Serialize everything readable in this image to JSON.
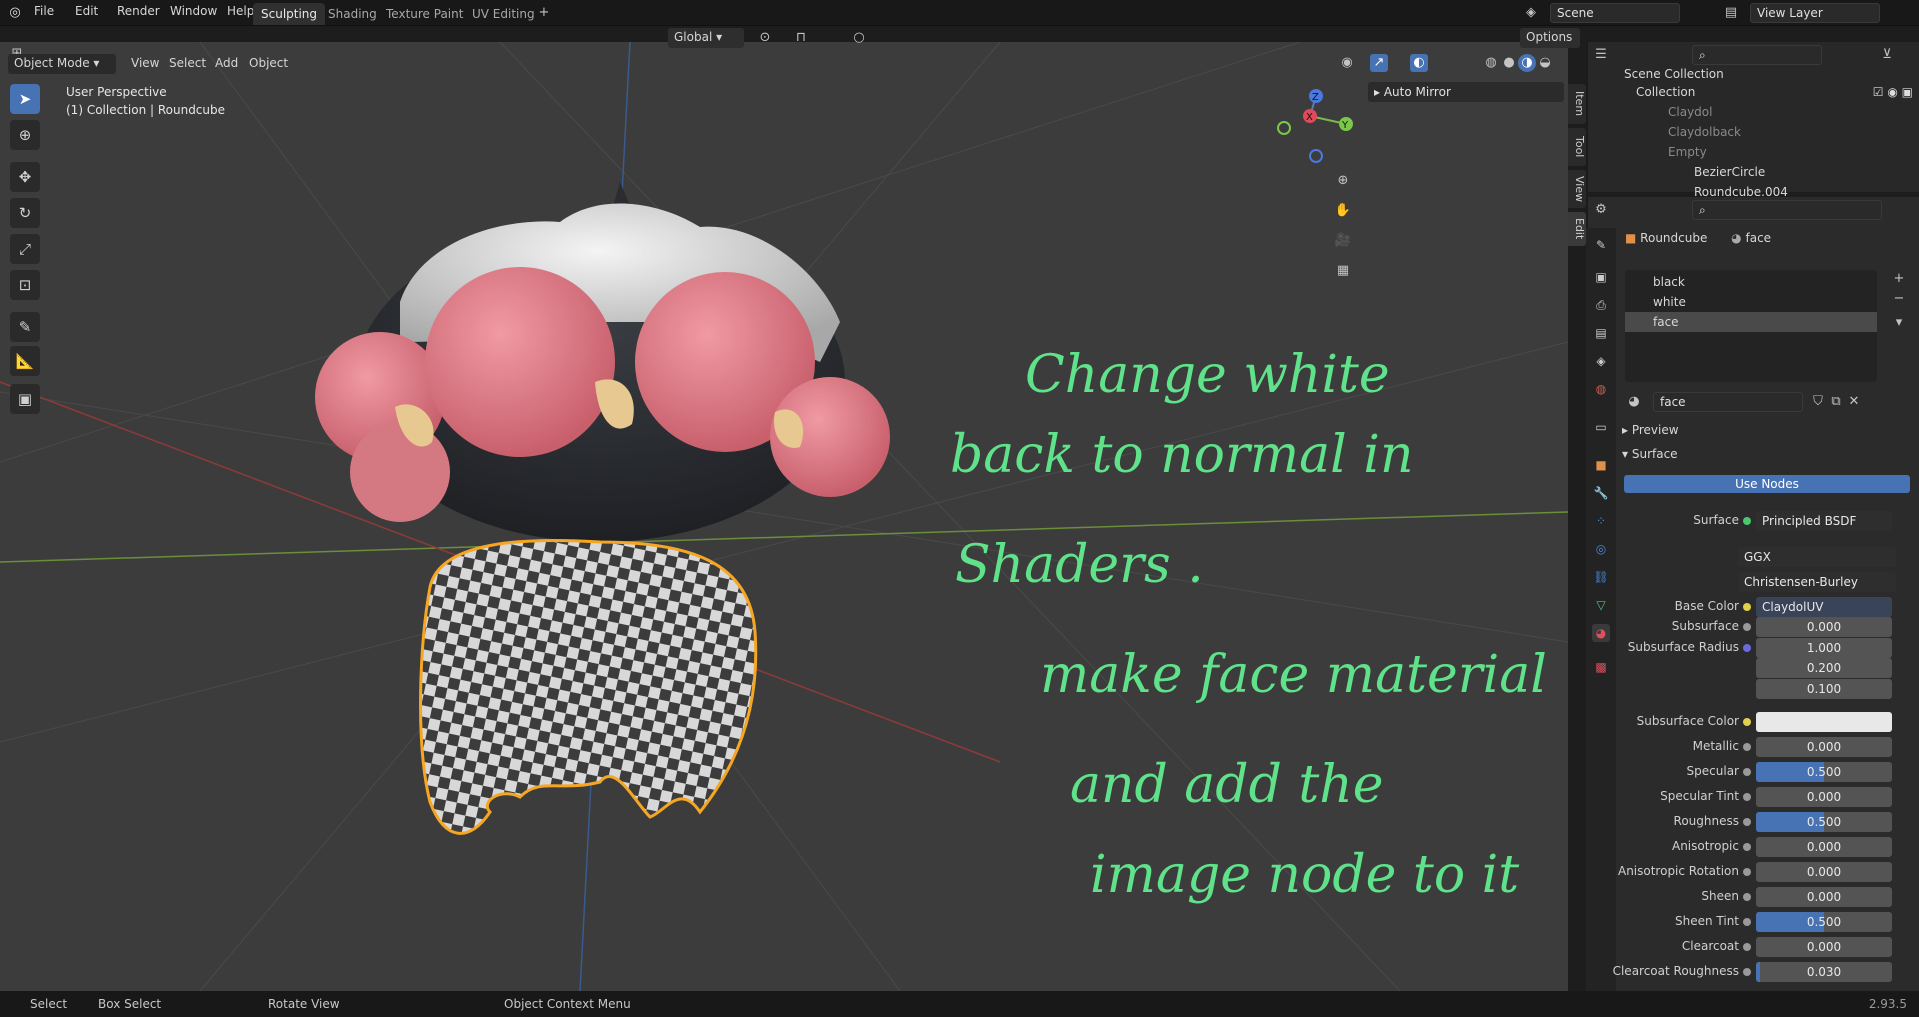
{
  "topbar": {
    "menus": [
      "File",
      "Edit",
      "Render",
      "Window",
      "Help"
    ],
    "workspaces": [
      "Sculpting",
      "Shading",
      "Texture Paint",
      "UV Editing"
    ],
    "active_workspace": "Sculpting",
    "scene": "Scene",
    "view_layer": "View Layer"
  },
  "viewport_header": {
    "mode": "Object Mode",
    "menus": [
      "View",
      "Select",
      "Add",
      "Object"
    ],
    "transform_orientation": "Global",
    "options": "Options"
  },
  "viewport": {
    "perspective": "User Perspective",
    "context": "(1) Collection | Roundcube",
    "auto_mirror": "Auto Mirror",
    "side_tabs": [
      "Item",
      "Tool",
      "View",
      "Edit"
    ],
    "gizmo_axes": [
      "Z",
      "X",
      "Y"
    ]
  },
  "annotation": {
    "lines": [
      "Change white",
      "back to normal in",
      "Shaders .",
      "make face material",
      "and add the",
      "image node to it"
    ]
  },
  "outliner": {
    "root": "Scene Collection",
    "items": [
      {
        "label": "Collection"
      },
      {
        "label": "Claydol"
      },
      {
        "label": "Claydolback"
      },
      {
        "label": "Empty"
      },
      {
        "label": "BezierCircle"
      },
      {
        "label": "Roundcube.004"
      }
    ]
  },
  "properties": {
    "breadcrumb_object": "Roundcube",
    "breadcrumb_material": "face",
    "slots": [
      "black",
      "white",
      "face"
    ],
    "active_slot": "face",
    "material_name": "face",
    "panels": {
      "preview": "Preview",
      "surface": "Surface"
    },
    "use_nodes": "Use Nodes",
    "surface_label": "Surface",
    "surface_shader": "Principled BSDF",
    "distribution": "GGX",
    "subsurface_method": "Christensen-Burley",
    "base_color_label": "Base Color",
    "base_color_value": "ClaydolUV",
    "rows": [
      {
        "label": "Subsurface",
        "value": "0.000",
        "fill": 0
      },
      {
        "label": "Subsurface Radius",
        "value": "1.000",
        "fill": 0
      },
      {
        "label": "",
        "value": "0.200",
        "fill": 0
      },
      {
        "label": "",
        "value": "0.100",
        "fill": 0
      }
    ],
    "subsurface_color_label": "Subsurface Color",
    "rows2": [
      {
        "label": "Metallic",
        "value": "0.000",
        "fill": 0
      },
      {
        "label": "Specular",
        "value": "0.500",
        "fill": 0.5
      },
      {
        "label": "Specular Tint",
        "value": "0.000",
        "fill": 0
      },
      {
        "label": "Roughness",
        "value": "0.500",
        "fill": 0.5
      },
      {
        "label": "Anisotropic",
        "value": "0.000",
        "fill": 0
      },
      {
        "label": "Anisotropic Rotation",
        "value": "0.000",
        "fill": 0
      },
      {
        "label": "Sheen",
        "value": "0.000",
        "fill": 0
      },
      {
        "label": "Sheen Tint",
        "value": "0.500",
        "fill": 0.5
      },
      {
        "label": "Clearcoat",
        "value": "0.000",
        "fill": 0
      },
      {
        "label": "Clearcoat Roughness",
        "value": "0.030",
        "fill": 0.03
      }
    ]
  },
  "statusbar": {
    "items": [
      "Select",
      "Box Select",
      "Rotate View",
      "Object Context Menu"
    ],
    "version": "2.93.5"
  },
  "colors": {
    "accent": "#4772b3",
    "annotation": "#5fe28a",
    "selection_outline": "#f5a623"
  }
}
